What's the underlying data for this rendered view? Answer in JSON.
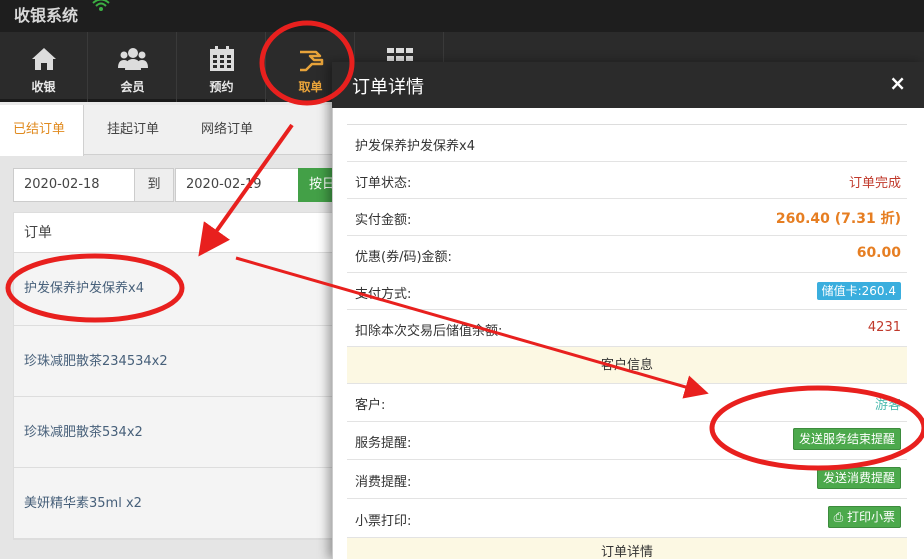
{
  "app": {
    "title": "收银系统"
  },
  "nav": [
    {
      "label": "收银",
      "icon": "home-icon"
    },
    {
      "label": "会员",
      "icon": "users-icon"
    },
    {
      "label": "预约",
      "icon": "calendar-icon"
    },
    {
      "label": "取单",
      "icon": "hand-icon"
    },
    {
      "label": "",
      "icon": "grid-icon"
    }
  ],
  "tabs": [
    "已结订单",
    "挂起订单",
    "网络订单"
  ],
  "filter": {
    "start_date": "2020-02-18",
    "separator": "到",
    "end_date": "2020-02-19",
    "button_label": "按日"
  },
  "orders": {
    "header": "订单",
    "rows": [
      "护发保养护发保养x4",
      "珍珠减肥散茶234534x2",
      "珍珠减肥散茶534x2",
      "美妍精华素35ml x2"
    ]
  },
  "modal": {
    "title": "订单详情",
    "close": "×",
    "item": "护发保养护发保养x4",
    "status_label": "订单状态:",
    "status_value": "订单完成",
    "paid_label": "实付金额:",
    "paid_value": "260.40 (7.31 折)",
    "discount_label": "优惠(券/码)金额:",
    "discount_value": "60.00",
    "payment_label": "支付方式:",
    "payment_value": "储值卡:260.4",
    "balance_label": "扣除本次交易后储值余额:",
    "balance_value": "4231",
    "customer_section": "客户信息",
    "customer_label": "客户:",
    "customer_value": "游客",
    "service_label": "服务提醒:",
    "service_button": "发送服务结束提醒",
    "consume_label": "消费提醒:",
    "consume_button": "发送消费提醒",
    "print_label": "小票打印:",
    "print_button": "打印小票",
    "order_section": "订单详情"
  },
  "colors": {
    "annotation": "#e8201e",
    "accent": "#e08a1e",
    "green": "#4ca94c"
  }
}
